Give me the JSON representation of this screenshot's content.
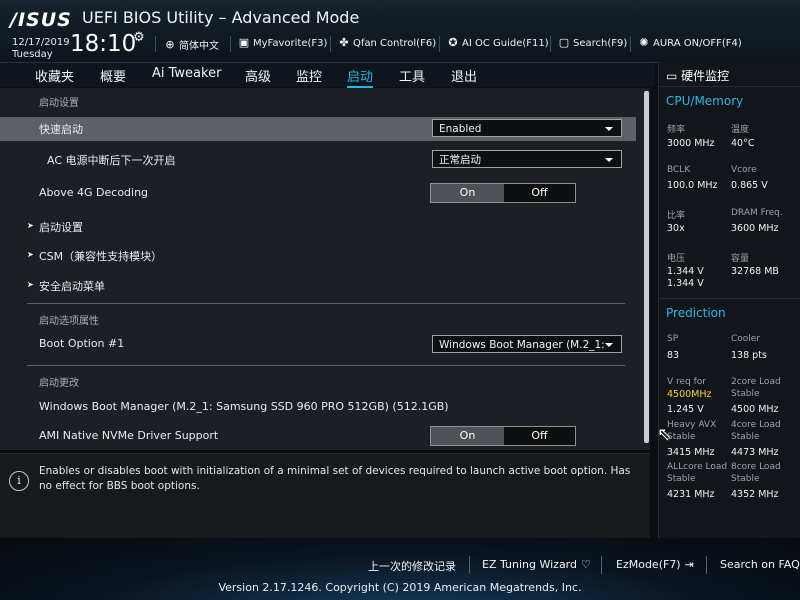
{
  "header": {
    "logo": "/ISUS",
    "title": "UEFI BIOS Utility – Advanced Mode",
    "date": "12/17/2019",
    "weekday": "Tuesday",
    "time": "18:10",
    "tools": {
      "language": "简体中文",
      "myfavorite": "MyFavorite(F3)",
      "qfan": "Qfan Control(F6)",
      "aioc": "AI OC Guide(F11)",
      "search": "Search(F9)",
      "aura": "AURA ON/OFF(F4)"
    }
  },
  "tabs": [
    "收藏夹",
    "概要",
    "Ai Tweaker",
    "高级",
    "监控",
    "启动",
    "工具",
    "退出"
  ],
  "active_tab": "启动",
  "content": {
    "section_boot_config": "启动设置",
    "fast_boot": {
      "label": "快速启动",
      "value": "Enabled"
    },
    "ac_power": {
      "label": "AC 电源中断后下一次开启",
      "value": "正常启动"
    },
    "above4g": {
      "label": "Above 4G Decoding",
      "on": "On",
      "off": "Off"
    },
    "sub_boot_config": "启动设置",
    "sub_csm": "CSM（兼容性支持模块）",
    "sub_secure_boot": "安全启动菜单",
    "section_boot_priority": "启动选项属性",
    "boot_option1": {
      "label": "Boot Option #1",
      "value": "Windows Boot Manager (M.2_1:"
    },
    "section_boot_override": "启动更改",
    "override_item": "Windows Boot Manager (M.2_1: Samsung SSD 960 PRO 512GB) (512.1GB)",
    "ami_nvme": {
      "label": "AMI Native NVMe Driver Support",
      "on": "On",
      "off": "Off"
    }
  },
  "help": {
    "icon": "i",
    "text": "Enables or disables boot with initialization of a minimal set of devices required to launch active boot option. Has no effect for BBS boot options."
  },
  "monitor": {
    "title": "硬件监控",
    "cpu_memory": {
      "heading": "CPU/Memory",
      "freq_label": "频率",
      "freq_value": "3000 MHz",
      "temp_label": "温度",
      "temp_value": "40°C",
      "bclk_label": "BCLK",
      "bclk_value": "100.0 MHz",
      "vcore_label": "Vcore",
      "vcore_value": "0.865 V",
      "ratio_label": "比率",
      "ratio_value": "30x",
      "dram_label": "DRAM Freq.",
      "dram_value": "3600 MHz",
      "volt_label": "电压",
      "volt_value1": "1.344 V",
      "volt_value2": "1.344 V",
      "cap_label": "容量",
      "cap_value": "32768 MB"
    },
    "prediction": {
      "heading": "Prediction",
      "sp_label": "SP",
      "sp_value": "83",
      "cooler_label": "Cooler",
      "cooler_value": "138 pts",
      "vreq_label": "V req for",
      "vreq_freq": "4500MHz",
      "vreq_value": "1.245 V",
      "core2_label": "2core Load",
      "core2_stable": "Stable",
      "core2_value": "4500 MHz",
      "heavy_label": "Heavy AVX",
      "heavy_stable": "Stable",
      "heavy_value": "3415 MHz",
      "core4_label": "4core Load",
      "core4_stable": "Stable",
      "core4_value": "4473 MHz",
      "allcore_label": "ALLcore Load",
      "allcore_stable": "Stable",
      "allcore_value": "4231 MHz",
      "core8_label": "8core Load",
      "core8_stable": "Stable",
      "core8_value": "4352 MHz"
    }
  },
  "footer": {
    "last_modified": "上一次的修改记录",
    "ez_tuning": "EZ Tuning Wizard",
    "ezmode": "EzMode(F7)",
    "search_faq": "Search on FAQ",
    "version": "Version 2.17.1246. Copyright (C) 2019 American Megatrends, Inc."
  },
  "colors": {
    "accent": "#26b7e6",
    "highlight_row": "#5d6166",
    "yellow_value": "#f3d23a"
  }
}
